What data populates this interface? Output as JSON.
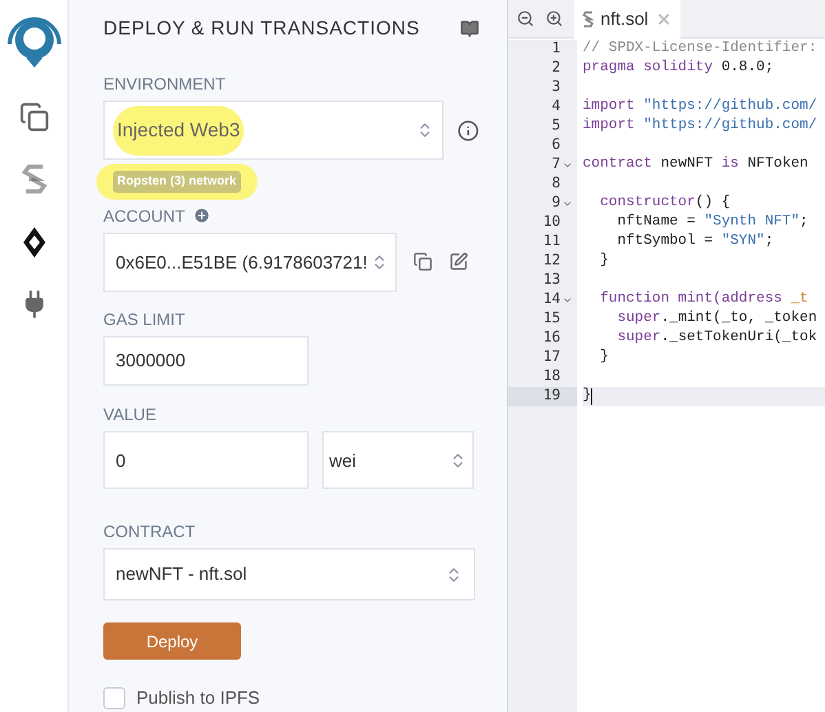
{
  "sidebar": {
    "icons": [
      {
        "kind": "files",
        "selected": false
      },
      {
        "kind": "compiler",
        "selected": false
      },
      {
        "kind": "deploy",
        "selected": true
      },
      {
        "kind": "plugin",
        "selected": false
      }
    ]
  },
  "panel": {
    "title": "DEPLOY & RUN TRANSACTIONS",
    "environment": {
      "label": "ENVIRONMENT",
      "value": "Injected Web3",
      "network": "Ropsten (3) network"
    },
    "account": {
      "label": "ACCOUNT",
      "value": "0x6E0...E51BE (6.9178603721!"
    },
    "gas_limit": {
      "label": "GAS LIMIT",
      "value": "3000000"
    },
    "value": {
      "label": "VALUE",
      "amount": "0",
      "unit": "wei"
    },
    "contract": {
      "label": "CONTRACT",
      "value": "newNFT - nft.sol"
    },
    "deploy_button": "Deploy",
    "publish": {
      "label": "Publish to IPFS",
      "checked": false
    }
  },
  "editor": {
    "tab": {
      "title": "nft.sol"
    },
    "lines": [
      {
        "number": "1",
        "foldable": false,
        "active": false,
        "tokens": [
          {
            "kind": "comment",
            "text": "// SPDX-License-Identifier:"
          }
        ]
      },
      {
        "number": "2",
        "foldable": false,
        "active": false,
        "tokens": [
          {
            "kind": "keyword",
            "text": "pragma solidity"
          },
          {
            "kind": "plain",
            "text": " 0.8.0;"
          }
        ]
      },
      {
        "number": "3",
        "foldable": false,
        "active": false
      },
      {
        "number": "4",
        "foldable": false,
        "active": false,
        "tokens": [
          {
            "kind": "keyword",
            "text": "import"
          },
          {
            "kind": "string",
            "text": " \"https://github.com/"
          }
        ]
      },
      {
        "number": "5",
        "foldable": false,
        "active": false,
        "tokens": [
          {
            "kind": "keyword",
            "text": "import"
          },
          {
            "kind": "string",
            "text": " \"https://github.com/"
          }
        ]
      },
      {
        "number": "6",
        "foldable": false,
        "active": false
      },
      {
        "number": "7",
        "foldable": true,
        "active": false,
        "tokens": [
          {
            "kind": "keyword",
            "text": "contract"
          },
          {
            "kind": "plain",
            "text": " newNFT "
          },
          {
            "kind": "keyword",
            "text": "is"
          },
          {
            "kind": "plain",
            "text": " NFToken"
          }
        ]
      },
      {
        "number": "8",
        "foldable": false,
        "active": false
      },
      {
        "number": "9",
        "foldable": true,
        "active": false,
        "tokens": [
          {
            "kind": "keyword",
            "text": "  constructor"
          },
          {
            "kind": "plain",
            "text": "() {"
          }
        ]
      },
      {
        "number": "10",
        "foldable": false,
        "active": false,
        "tokens": [
          {
            "kind": "plain",
            "text": "    nftName = "
          },
          {
            "kind": "string",
            "text": "\"Synth NFT\""
          },
          {
            "kind": "plain",
            "text": ";"
          }
        ]
      },
      {
        "number": "11",
        "foldable": false,
        "active": false,
        "tokens": [
          {
            "kind": "plain",
            "text": "    nftSymbol = "
          },
          {
            "kind": "string",
            "text": "\"SYN\""
          },
          {
            "kind": "plain",
            "text": ";"
          }
        ]
      },
      {
        "number": "12",
        "foldable": false,
        "active": false,
        "tokens": [
          {
            "kind": "plain",
            "text": "  }"
          }
        ]
      },
      {
        "number": "13",
        "foldable": false,
        "active": false
      },
      {
        "number": "14",
        "foldable": true,
        "active": false,
        "tokens": [
          {
            "kind": "keyword",
            "text": "  function mint(address"
          },
          {
            "kind": "param",
            "text": " _t"
          }
        ]
      },
      {
        "number": "15",
        "foldable": false,
        "active": false,
        "tokens": [
          {
            "kind": "keyword",
            "text": "    super"
          },
          {
            "kind": "plain",
            "text": "._mint(_to, _token"
          }
        ]
      },
      {
        "number": "16",
        "foldable": false,
        "active": false,
        "tokens": [
          {
            "kind": "keyword",
            "text": "    super"
          },
          {
            "kind": "plain",
            "text": "._setTokenUri(_tok"
          }
        ]
      },
      {
        "number": "17",
        "foldable": false,
        "active": false,
        "tokens": [
          {
            "kind": "plain",
            "text": "  }"
          }
        ]
      },
      {
        "number": "18",
        "foldable": false,
        "active": false
      },
      {
        "number": "19",
        "foldable": false,
        "active": true,
        "tokens": [
          {
            "kind": "plain",
            "text": "}"
          }
        ]
      }
    ]
  }
}
